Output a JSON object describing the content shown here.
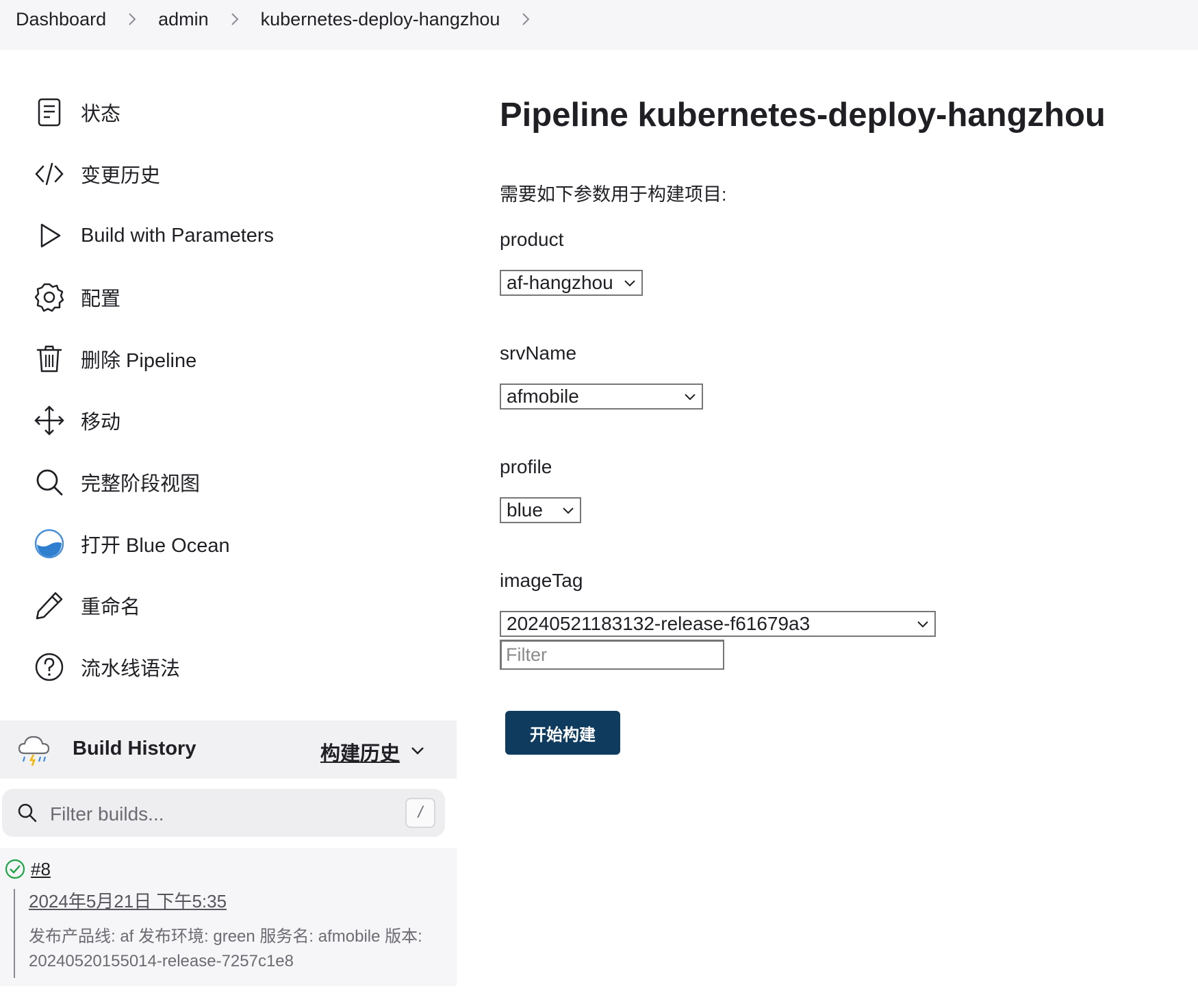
{
  "breadcrumb": {
    "items": [
      "Dashboard",
      "admin",
      "kubernetes-deploy-hangzhou"
    ]
  },
  "sidebar": {
    "items": [
      {
        "label": "状态",
        "icon": "document-icon"
      },
      {
        "label": "变更历史",
        "icon": "code-icon"
      },
      {
        "label": "Build with Parameters",
        "icon": "play-icon"
      },
      {
        "label": "配置",
        "icon": "gear-icon"
      },
      {
        "label": "删除 Pipeline",
        "icon": "trash-icon"
      },
      {
        "label": "移动",
        "icon": "move-icon"
      },
      {
        "label": "完整阶段视图",
        "icon": "search-icon"
      },
      {
        "label": "打开 Blue Ocean",
        "icon": "blue-ocean-icon"
      },
      {
        "label": "重命名",
        "icon": "pencil-icon"
      },
      {
        "label": "流水线语法",
        "icon": "help-icon"
      }
    ]
  },
  "build_history": {
    "title": "Build History",
    "trend_label": "构建历史",
    "filter_placeholder": "Filter builds...",
    "shortcut": "/",
    "builds": [
      {
        "number": "#8",
        "date": "2024年5月21日 下午5:35",
        "description": "发布产品线: af 发布环境: green 服务名: afmobile 版本: 20240520155014-release-7257c1e8",
        "status": "success"
      }
    ]
  },
  "main": {
    "title": "Pipeline kubernetes-deploy-hangzhou",
    "intro": "需要如下参数用于构建项目:",
    "params": [
      {
        "name": "product",
        "value": "af-hangzhou"
      },
      {
        "name": "srvName",
        "value": "afmobile"
      },
      {
        "name": "profile",
        "value": "blue"
      },
      {
        "name": "imageTag",
        "value": "20240521183132-release-f61679a3",
        "filter_placeholder": "Filter"
      }
    ],
    "submit_label": "开始构建"
  },
  "colors": {
    "accent": "#0f3b5f",
    "success": "#1ea446",
    "topbar": "#f6f6f8"
  }
}
